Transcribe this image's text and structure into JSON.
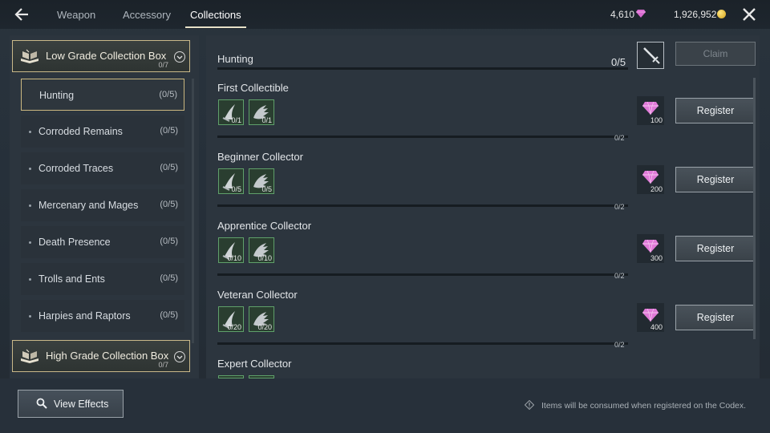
{
  "tabs": [
    {
      "label": "Weapon",
      "active": false
    },
    {
      "label": "Accessory",
      "active": false
    },
    {
      "label": "Collections",
      "active": true
    }
  ],
  "currency": {
    "gems": "4,610",
    "gold": "1,926,952"
  },
  "sidebar": {
    "boxes": [
      {
        "title": "Low Grade Collection Box",
        "count": "0/7"
      },
      {
        "title": "High Grade Collection Box",
        "count": "0/7"
      }
    ],
    "items": [
      {
        "label": "Hunting",
        "count": "(0/5)",
        "active": true
      },
      {
        "label": "Corroded Remains",
        "count": "(0/5)"
      },
      {
        "label": "Corroded Traces",
        "count": "(0/5)"
      },
      {
        "label": "Mercenary and Mages",
        "count": "(0/5)"
      },
      {
        "label": "Death Presence",
        "count": "(0/5)"
      },
      {
        "label": "Trolls and Ents",
        "count": "(0/5)"
      },
      {
        "label": "Harpies and Raptors",
        "count": "(0/5)"
      }
    ]
  },
  "main": {
    "section": {
      "title": "Hunting",
      "count": "0/5",
      "claim_label": "Claim"
    },
    "collections": [
      {
        "title": "First Collectible",
        "items": [
          {
            "qty": "0/1"
          },
          {
            "qty": "0/1"
          }
        ],
        "progress": "0/2",
        "reward": "100",
        "button": "Register"
      },
      {
        "title": "Beginner Collector",
        "items": [
          {
            "qty": "0/5"
          },
          {
            "qty": "0/5"
          }
        ],
        "progress": "0/2",
        "reward": "200",
        "button": "Register"
      },
      {
        "title": "Apprentice Collector",
        "items": [
          {
            "qty": "0/10"
          },
          {
            "qty": "0/10"
          }
        ],
        "progress": "0/2",
        "reward": "300",
        "button": "Register"
      },
      {
        "title": "Veteran Collector",
        "items": [
          {
            "qty": "0/20"
          },
          {
            "qty": "0/20"
          }
        ],
        "progress": "0/2",
        "reward": "400",
        "button": "Register"
      },
      {
        "title": "Expert Collector"
      }
    ]
  },
  "footer": {
    "view_effects": "View Effects",
    "notice": "Items will be consumed when registered on the Codex."
  },
  "colors": {
    "accent_border": "#c9b889",
    "gem": "#e07ad8",
    "gold": "#e3b53a",
    "slot_border": "#5fa06a"
  }
}
